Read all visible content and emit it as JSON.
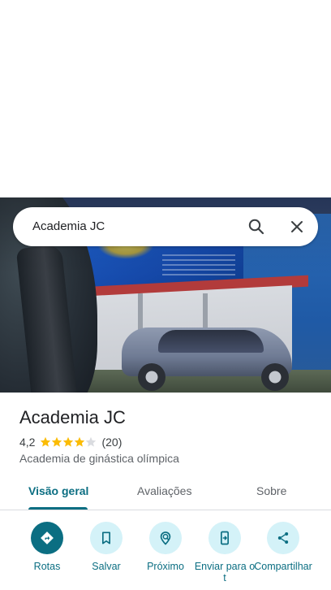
{
  "search": {
    "query": "Academia JC",
    "search_icon": "search-icon",
    "close_icon": "close-icon"
  },
  "place": {
    "title": "Academia JC",
    "rating": "4,2",
    "rating_fraction": 0.84,
    "stars": {
      "filled": 4,
      "total": 5
    },
    "review_count": "(20)",
    "category": "Academia de ginástica olímpica"
  },
  "tabs": [
    {
      "label": "Visão geral",
      "active": true
    },
    {
      "label": "Avaliações",
      "active": false
    },
    {
      "label": "Sobre",
      "active": false
    }
  ],
  "actions": [
    {
      "label": "Rotas",
      "icon": "directions-icon"
    },
    {
      "label": "Salvar",
      "icon": "bookmark-icon"
    },
    {
      "label": "Próximo",
      "icon": "nearby-icon"
    },
    {
      "label": "Enviar para o t",
      "icon": "send-to-phone-icon"
    },
    {
      "label": "Compartilhar",
      "icon": "share-icon"
    }
  ],
  "colors": {
    "accent": "#0b6e82",
    "accent_light": "#d4f2f8",
    "star": "#fbbc04",
    "star_empty": "#dadce0"
  }
}
